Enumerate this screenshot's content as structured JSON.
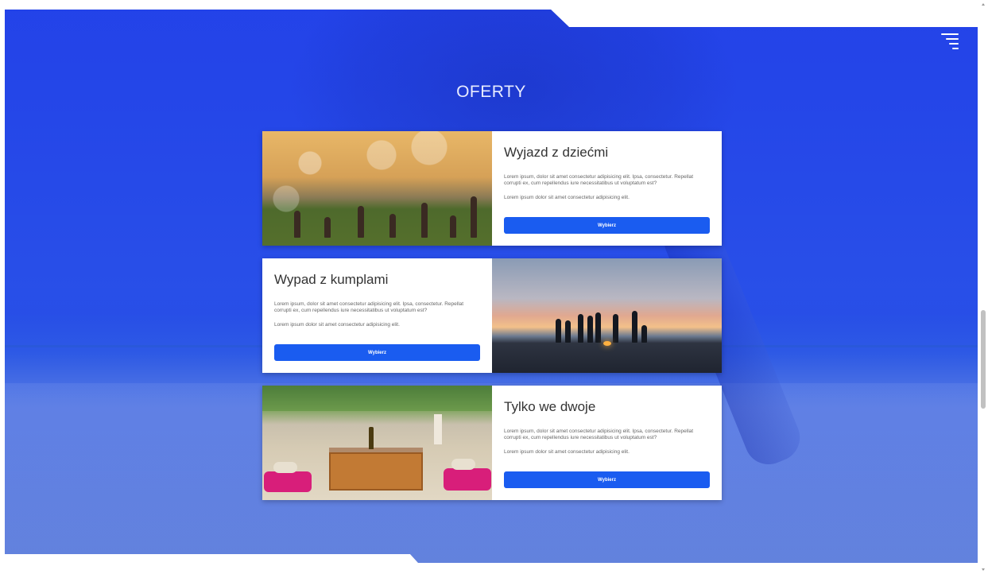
{
  "page": {
    "title": "OFERTY"
  },
  "header": {
    "menu_icon": "hamburger-menu-icon"
  },
  "offers": [
    {
      "title": "Wyjazd z dziećmi",
      "description": "Lorem ipsum, dolor sit amet consectetur adipisicing elit. Ipsa, consectetur. Repellat corrupti ex, cum repellendus iure necessitatibus ut voluptatum est?",
      "note": "Lorem ipsum dolor sit amet consectetur adipisicing elit.",
      "button_label": "Wybierz",
      "image": "kids-with-bubbles-photo"
    },
    {
      "title": "Wypad z kumplami",
      "description": "Lorem ipsum, dolor sit amet consectetur adipisicing elit. Ipsa, consectetur. Repellat corrupti ex, cum repellendus iure necessitatibus ut voluptatum est?",
      "note": "Lorem ipsum dolor sit amet consectetur adipisicing elit.",
      "button_label": "Wybierz",
      "image": "friends-beach-sunset-photo"
    },
    {
      "title": "Tylko we dwoje",
      "description": "Lorem ipsum, dolor sit amet consectetur adipisicing elit. Ipsa, consectetur. Repellat corrupti ex, cum repellendus iure necessitatibus ut voluptatum est?",
      "note": "Lorem ipsum dolor sit amet consectetur adipisicing elit.",
      "button_label": "Wybierz",
      "image": "romantic-beach-dinner-photo"
    }
  ],
  "colors": {
    "hero_overlay": "#1f3ceb",
    "button": "#1a5cf0",
    "card_bg": "#ffffff"
  }
}
